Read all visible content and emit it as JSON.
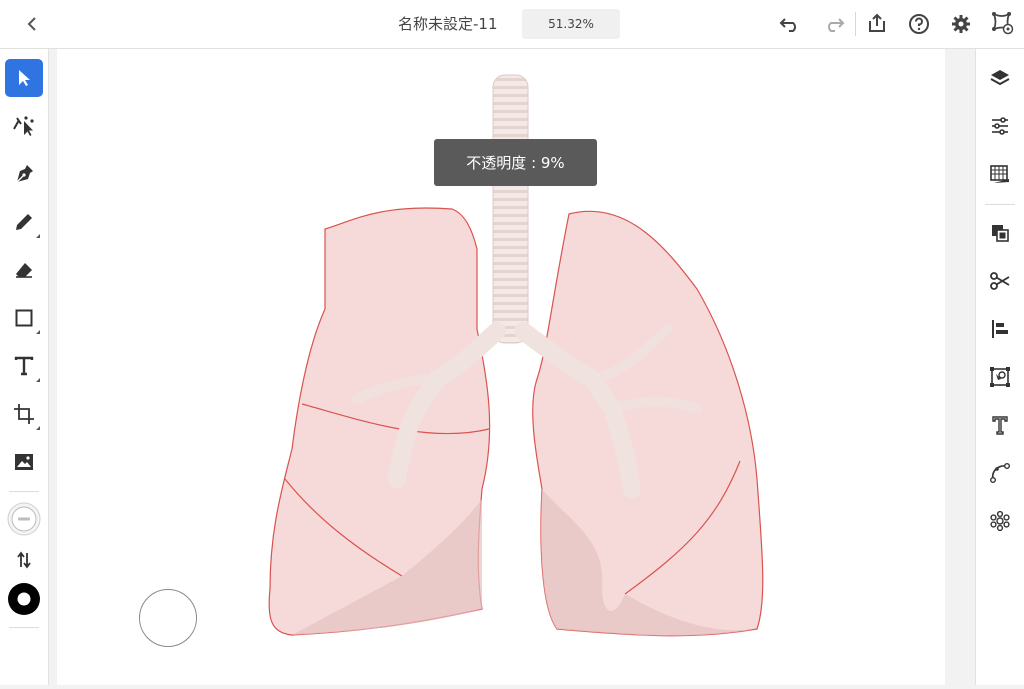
{
  "topbar": {
    "title": "名称未設定-11",
    "zoom": "51.32%",
    "icons": [
      "back-chevron-icon",
      "undo-icon",
      "redo-icon",
      "share-icon",
      "help-icon",
      "settings-icon",
      "cloud-doc-status-icon"
    ]
  },
  "tools": [
    "select-tool",
    "direct-select-tool",
    "pen-tool",
    "pencil-tool",
    "eraser-tool",
    "rectangle-tool",
    "type-tool",
    "artboard-tool",
    "image-tool",
    "fill-stroke-swatch",
    "swap-fill-stroke",
    "stroke-swatch"
  ],
  "right_panel": [
    "layers-icon",
    "properties-icon",
    "swatches-libraries-icon",
    "arrange-icon",
    "scissors-icon",
    "align-icon",
    "transform-icon",
    "type-panel-icon",
    "path-icon",
    "repeat-icon"
  ],
  "tooltip": {
    "text": "不透明度 : 9%"
  },
  "colors": {
    "accent": "#2f74e0",
    "lung_fill": "#f6dada",
    "lung_stroke": "#d9534f",
    "tooltip_bg": "#5a5a5a"
  }
}
